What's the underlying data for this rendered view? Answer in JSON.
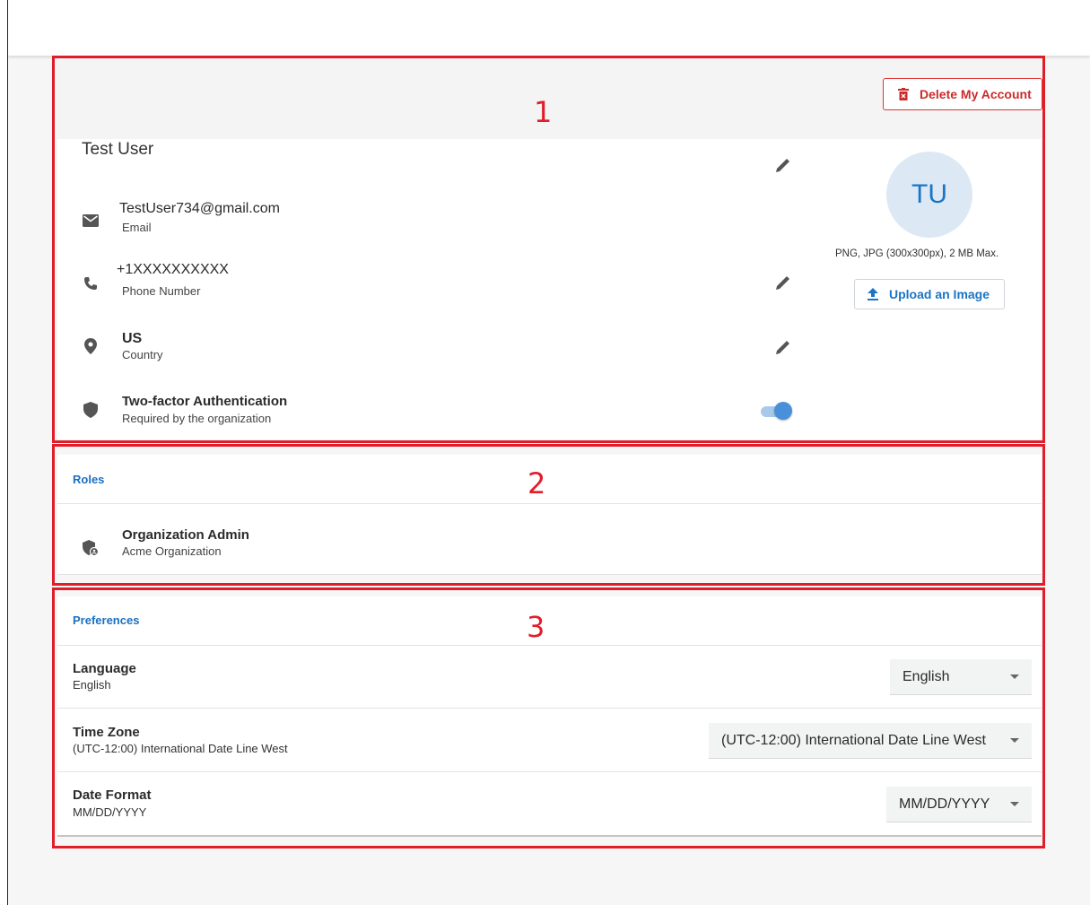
{
  "colors": {
    "accent": "#1b74c5",
    "danger": "#cc2b2b",
    "annotation": "#e11d2a"
  },
  "annotations": [
    "1",
    "2",
    "3"
  ],
  "profile": {
    "delete_label": "Delete My Account",
    "name": "Test User",
    "email": {
      "value": "TestUser734@gmail.com",
      "label": "Email",
      "icon": "envelope-icon"
    },
    "phone": {
      "value": "+1XXXXXXXXXX",
      "label": "Phone Number",
      "icon": "phone-icon"
    },
    "country": {
      "value": "US",
      "label": "Country",
      "icon": "location-pin-icon"
    },
    "two_factor": {
      "value": "Two-factor Authentication",
      "label": "Required by the organization",
      "icon": "shield-icon",
      "enabled": true
    },
    "avatar_initials": "TU",
    "avatar_note": "PNG, JPG (300x300px), 2 MB Max.",
    "upload_label": "Upload an Image"
  },
  "roles": {
    "title": "Roles",
    "items": [
      {
        "name": "Organization Admin",
        "org": "Acme Organization",
        "icon": "admin-shield-icon"
      }
    ]
  },
  "preferences": {
    "title": "Preferences",
    "language": {
      "label": "Language",
      "value": "English",
      "selected": "English"
    },
    "time_zone": {
      "label": "Time Zone",
      "value": "(UTC-12:00) International Date Line West",
      "selected": "(UTC-12:00) International Date Line West"
    },
    "date_format": {
      "label": "Date Format",
      "value": "MM/DD/YYYY",
      "selected": "MM/DD/YYYY"
    }
  }
}
